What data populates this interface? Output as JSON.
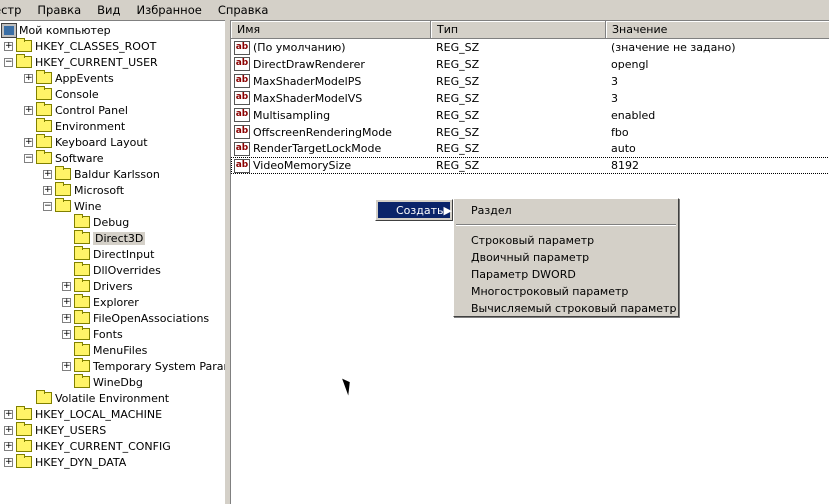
{
  "menu": [
    "естр",
    "Правка",
    "Вид",
    "Избранное",
    "Справка"
  ],
  "tree": [
    {
      "label": "Мой компьютер",
      "level": 0,
      "exp": "none",
      "icon": "computer"
    },
    {
      "label": "HKEY_CLASSES_ROOT",
      "level": 1,
      "exp": "+"
    },
    {
      "label": "HKEY_CURRENT_USER",
      "level": 1,
      "exp": "-"
    },
    {
      "label": "AppEvents",
      "level": 2,
      "exp": "+"
    },
    {
      "label": "Console",
      "level": 2,
      "exp": ""
    },
    {
      "label": "Control Panel",
      "level": 2,
      "exp": "+"
    },
    {
      "label": "Environment",
      "level": 2,
      "exp": ""
    },
    {
      "label": "Keyboard Layout",
      "level": 2,
      "exp": "+"
    },
    {
      "label": "Software",
      "level": 2,
      "exp": "-"
    },
    {
      "label": "Baldur Karlsson",
      "level": 3,
      "exp": "+"
    },
    {
      "label": "Microsoft",
      "level": 3,
      "exp": "+"
    },
    {
      "label": "Wine",
      "level": 3,
      "exp": "-"
    },
    {
      "label": "Debug",
      "level": 4,
      "exp": ""
    },
    {
      "label": "Direct3D",
      "level": 4,
      "exp": "",
      "selected": true
    },
    {
      "label": "DirectInput",
      "level": 4,
      "exp": ""
    },
    {
      "label": "DllOverrides",
      "level": 4,
      "exp": ""
    },
    {
      "label": "Drivers",
      "level": 4,
      "exp": "+"
    },
    {
      "label": "Explorer",
      "level": 4,
      "exp": "+"
    },
    {
      "label": "FileOpenAssociations",
      "level": 4,
      "exp": "+"
    },
    {
      "label": "Fonts",
      "level": 4,
      "exp": "+"
    },
    {
      "label": "MenuFiles",
      "level": 4,
      "exp": ""
    },
    {
      "label": "Temporary System Parameters",
      "level": 4,
      "exp": "+"
    },
    {
      "label": "WineDbg",
      "level": 4,
      "exp": ""
    },
    {
      "label": "Volatile Environment",
      "level": 2,
      "exp": ""
    },
    {
      "label": "HKEY_LOCAL_MACHINE",
      "level": 1,
      "exp": "+"
    },
    {
      "label": "HKEY_USERS",
      "level": 1,
      "exp": "+"
    },
    {
      "label": "HKEY_CURRENT_CONFIG",
      "level": 1,
      "exp": "+"
    },
    {
      "label": "HKEY_DYN_DATA",
      "level": 1,
      "exp": "+"
    }
  ],
  "list": {
    "headers": [
      "Имя",
      "Тип",
      "Значение"
    ],
    "icon_text": "ab",
    "rows": [
      [
        "(По умолчанию)",
        "REG_SZ",
        "(значение не задано)"
      ],
      [
        "DirectDrawRenderer",
        "REG_SZ",
        "opengl"
      ],
      [
        "MaxShaderModelPS",
        "REG_SZ",
        "3"
      ],
      [
        "MaxShaderModelVS",
        "REG_SZ",
        "3"
      ],
      [
        "Multisampling",
        "REG_SZ",
        "enabled"
      ],
      [
        "OffscreenRenderingMode",
        "REG_SZ",
        "fbo"
      ],
      [
        "RenderTargetLockMode",
        "REG_SZ",
        "auto"
      ],
      [
        "VideoMemorySize",
        "REG_SZ",
        "8192"
      ]
    ]
  },
  "context": {
    "create": "Создать",
    "submenu": [
      "Раздел",
      "Строковый параметр",
      "Двоичный параметр",
      "Параметр DWORD",
      "Многостроковый параметр",
      "Вычисляемый строковый параметр"
    ]
  }
}
